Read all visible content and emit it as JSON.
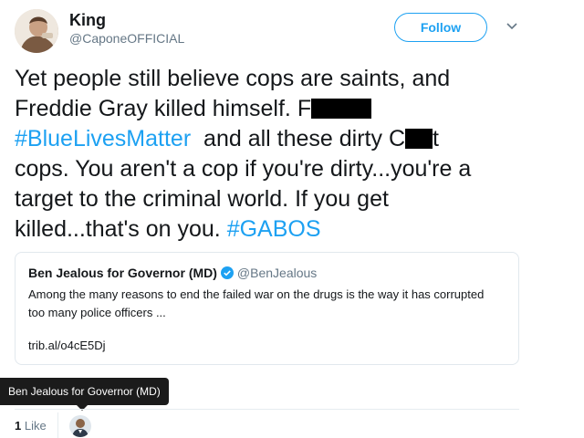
{
  "user": {
    "name": "King",
    "handle": "@CaponeOFFICIAL",
    "avatar_icon": "profile-photo"
  },
  "follow_button": {
    "label": "Follow"
  },
  "menu_icon": "chevron-down-icon",
  "tweet": {
    "line1": "Yet people still believe cops are saints, and",
    "line2_text": "Freddie Gray killed himself. F",
    "line3_hashtag": "#BlueLivesMatter",
    "line3_text": "  and all these dirty C",
    "line3_tail": "t",
    "line4": "cops. You aren't a cop if you're dirty...you're a",
    "line5": "target to the criminal world. If you get",
    "line6_text": "killed...that's on you. ",
    "line6_hashtag": "#GABOS"
  },
  "quoted_tweet": {
    "name": "Ben Jealous for Governor (MD)",
    "handle": "@BenJealous",
    "text": "Among the many reasons to end the failed war on the drugs is the way it has corrupted too many police officers ...",
    "link": "trib.al/o4cE5Dj"
  },
  "tooltip": {
    "text": "Ben Jealous for Governor (MD)"
  },
  "stats": {
    "like_count": "1",
    "like_label": "Like"
  },
  "colors": {
    "accent": "#1da1f2",
    "secondary_text": "#657786",
    "redaction": "#000000"
  }
}
